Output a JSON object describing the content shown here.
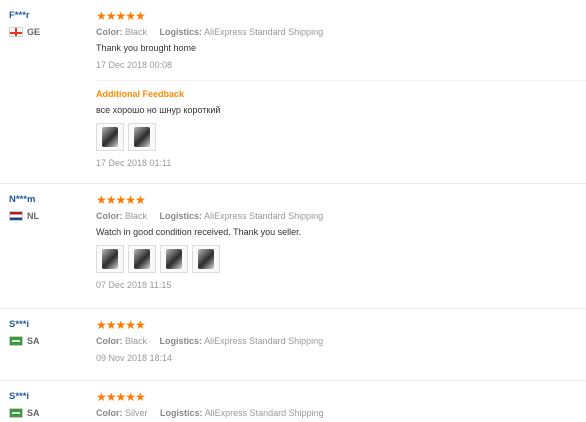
{
  "colors": {
    "stars": "#ff7a00",
    "username": "#1f5a9c",
    "additional_feedback": "#ff8a00"
  },
  "reviews": [
    {
      "username": "F***r",
      "country": "GE",
      "stars": "★★★★★",
      "color_label": "Color:",
      "color_value": "Black",
      "logistics_label": "Logistics:",
      "logistics_value": "AliExpress Standard Shipping",
      "text": "Thank you brought home",
      "date": "17 Dec 2018 00:08",
      "additional": {
        "title": "Additional Feedback",
        "text": "все хорошо но шнур короткий",
        "date": "17 Dec 2018 01:11",
        "thumbnails": 2
      }
    },
    {
      "username": "N***m",
      "country": "NL",
      "stars": "★★★★★",
      "color_label": "Color:",
      "color_value": "Black",
      "logistics_label": "Logistics:",
      "logistics_value": "AliExpress Standard Shipping",
      "text": "Watch in good condition received. Thank you seller.",
      "date": "07 Dec 2018 11:15",
      "thumbnails": 4
    },
    {
      "username": "S***i",
      "country": "SA",
      "stars": "★★★★★",
      "color_label": "Color:",
      "color_value": "Black",
      "logistics_label": "Logistics:",
      "logistics_value": "AliExpress Standard Shipping",
      "date": "09 Nov 2018 18:14"
    },
    {
      "username": "S***i",
      "country": "SA",
      "stars": "★★★★★",
      "color_label": "Color:",
      "color_value": "Silver",
      "logistics_label": "Logistics:",
      "logistics_value": "AliExpress Standard Shipping"
    }
  ]
}
